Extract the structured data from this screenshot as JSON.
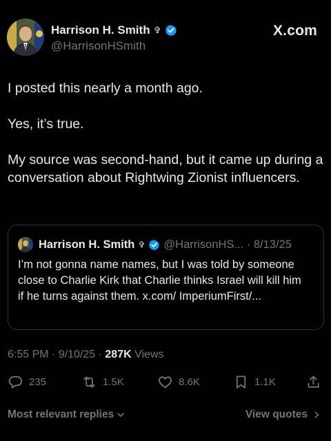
{
  "author": {
    "name": "Harrison H. Smith",
    "cross": "✞",
    "handle": "@HarrisonHSmith"
  },
  "brand": "X.com",
  "post": {
    "paragraphs": [
      "I posted this nearly a month ago.",
      "Yes, it’s true.",
      "My source was second-hand, but it came up during a conversation about Rightwing Zionist influencers."
    ],
    "timestamp": "6:55 PM · 9/10/25 · ",
    "views_count": "287K",
    "views_label": " Views"
  },
  "quote": {
    "name": "Harrison H. Smith",
    "cross": "✞",
    "handle_date": "@HarrisonHS... · 8/13/25",
    "text": "I’m not gonna name names, but I was told by someone close to Charlie Kirk that Charlie thinks Israel will kill him if he turns against them. x.com/ ImperiumFirst/..."
  },
  "actions": {
    "replies": "235",
    "reposts": "1.5K",
    "likes": "8.6K",
    "bookmarks": "1.1K"
  },
  "footer": {
    "sort_label": "Most relevant replies",
    "quotes_label": "View quotes"
  },
  "colors": {
    "background": "#000000",
    "text": "#e7e9ea",
    "muted": "#71767b",
    "verified": "#1d9bf0"
  }
}
